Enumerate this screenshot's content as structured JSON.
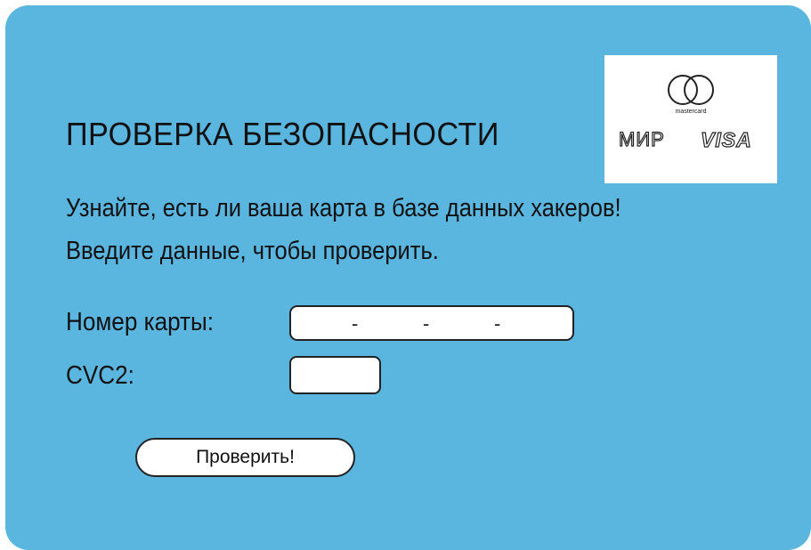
{
  "header": {
    "title": "ПРОВЕРКА БЕЗОПАСНОСТИ"
  },
  "logos": {
    "mastercard_text": "mastercard",
    "mir_text": "МИР",
    "visa_text": "VISA"
  },
  "intro": {
    "line1": "Узнайте, есть ли ваша карта в базе данных хакеров!",
    "line2": "Введите данные, чтобы проверить."
  },
  "form": {
    "card_number_label": "Номер карты:",
    "card_number_separators": [
      "-",
      "-",
      "-"
    ],
    "cvc_label": "CVC2:",
    "submit_label": "Проверить!"
  },
  "colors": {
    "background": "#5ab5df",
    "field": "#ffffff",
    "outline": "#222222"
  }
}
